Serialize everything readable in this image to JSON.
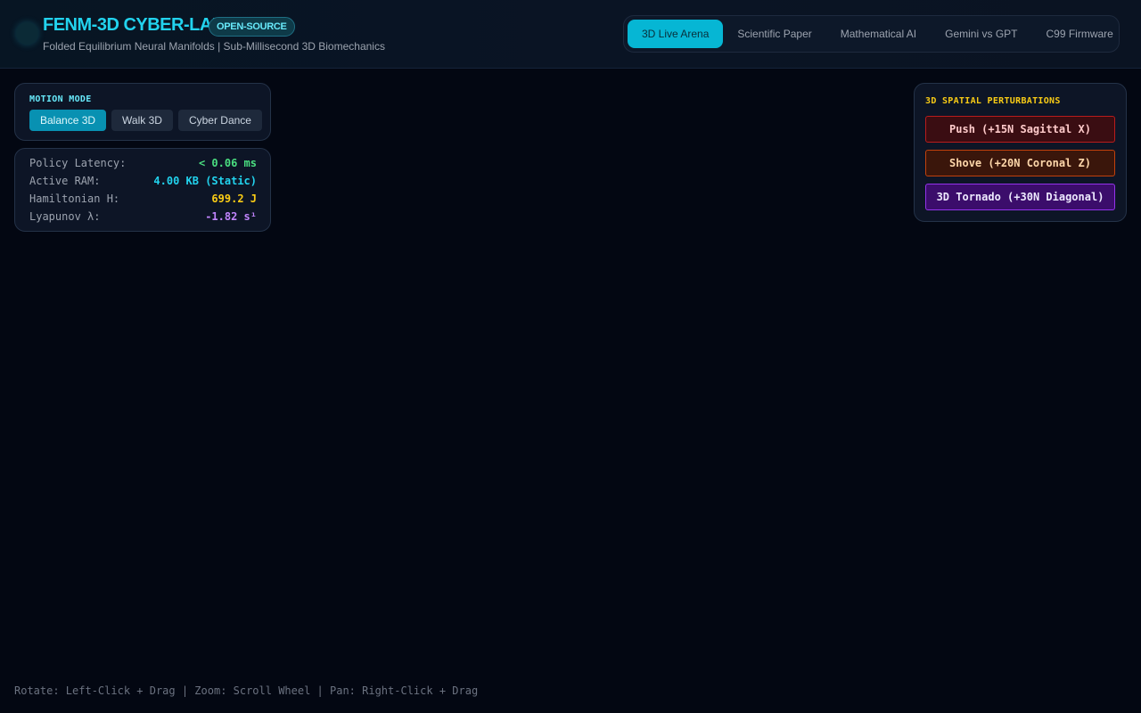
{
  "header": {
    "title": "FENM-3D CYBER-LAB",
    "badge": "OPEN-SOURCE",
    "subtitle": "Folded Equilibrium Neural Manifolds | Sub-Millisecond 3D Biomechanics",
    "logo_icon": "glow-orb-icon"
  },
  "nav": {
    "tabs": [
      {
        "label": "3D Live Arena",
        "active": true
      },
      {
        "label": "Scientific Paper",
        "active": false
      },
      {
        "label": "Mathematical AI",
        "active": false
      },
      {
        "label": "Gemini vs GPT",
        "active": false
      },
      {
        "label": "C99 Firmware",
        "active": false
      }
    ]
  },
  "motion": {
    "label": "MOTION MODE",
    "modes": [
      {
        "label": "Balance 3D",
        "active": true
      },
      {
        "label": "Walk 3D",
        "active": false
      },
      {
        "label": "Cyber Dance",
        "active": false
      }
    ]
  },
  "stats": [
    {
      "label": "Policy Latency:",
      "value": "< 0.06 ms",
      "color": "#4ade80"
    },
    {
      "label": "Active RAM:",
      "value": "4.00 KB (Static)",
      "color": "#22d3ee"
    },
    {
      "label": "Hamiltonian H:",
      "value": "699.2 J",
      "color": "#facc15"
    },
    {
      "label": "Lyapunov λ:",
      "value": "-1.82 s¹",
      "color": "#c084fc"
    }
  ],
  "perturbations": {
    "label": "3D SPATIAL PERTURBATIONS",
    "push": "Push (+15N Sagittal X)",
    "shove": "Shove (+20N Coronal Z)",
    "tornado": "3D Tornado (+30N Diagonal)"
  },
  "controls_hint": "Rotate: Left-Click + Drag | Zoom: Scroll Wheel | Pan: Right-Click + Drag",
  "colors": {
    "accent": "#22d3ee",
    "background": "#030712",
    "warning": "#facc15"
  }
}
